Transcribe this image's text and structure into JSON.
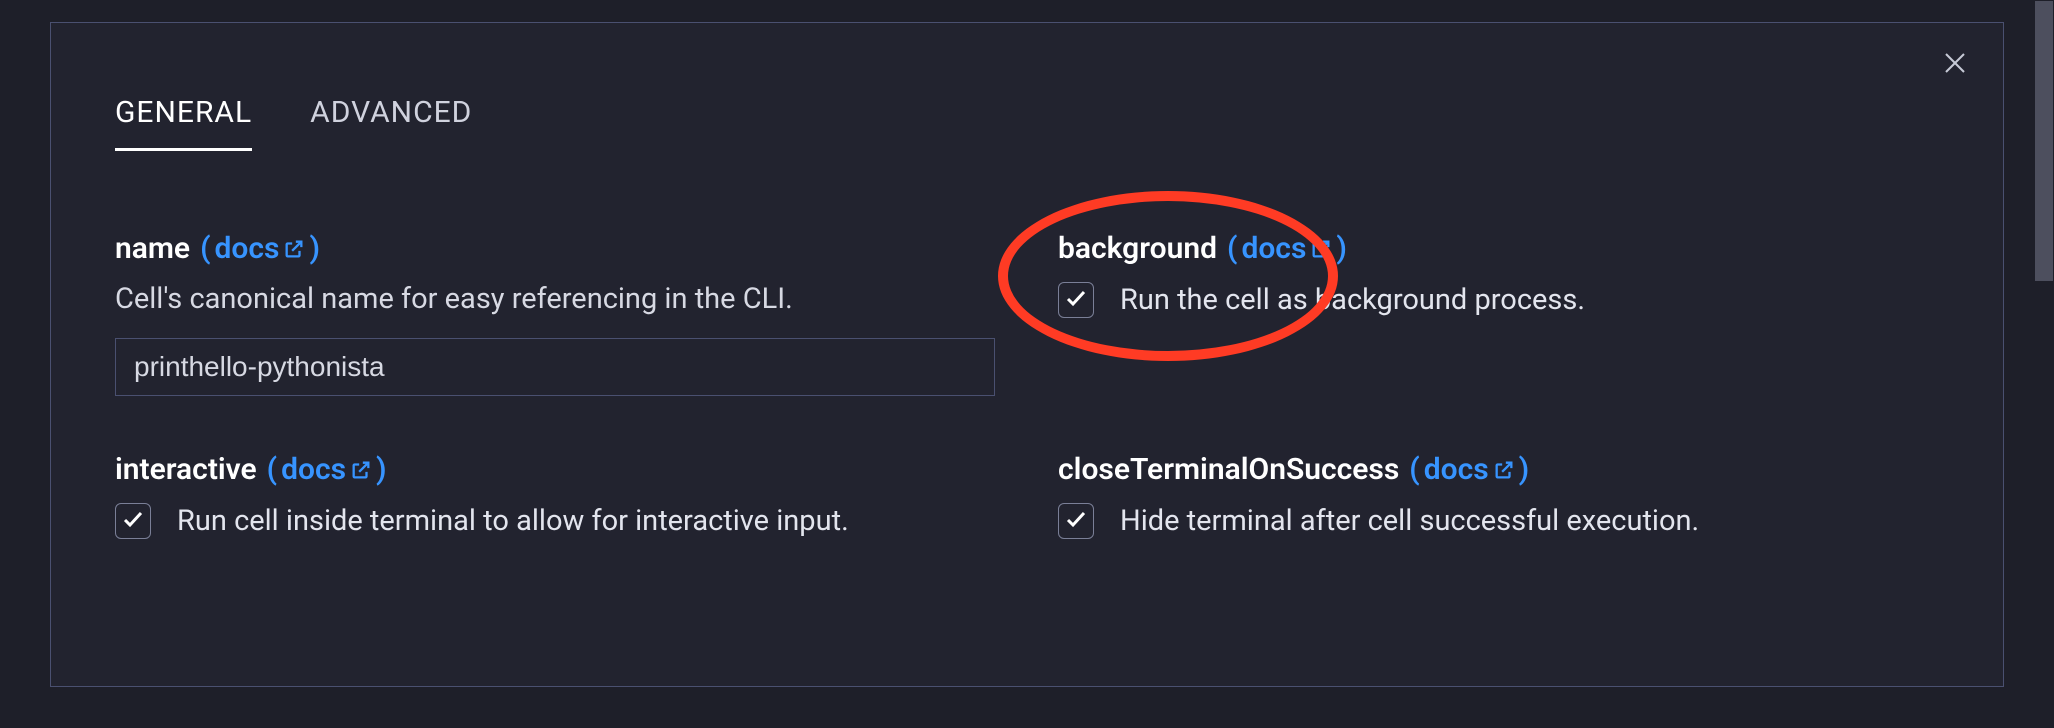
{
  "tabs": {
    "general": "GENERAL",
    "advanced": "ADVANCED"
  },
  "docs_label": "docs",
  "fields": {
    "name": {
      "label": "name",
      "description": "Cell's canonical name for easy referencing in the CLI.",
      "value": "printhello-pythonista"
    },
    "background": {
      "label": "background",
      "checkbox_label": "Run the cell as background process."
    },
    "interactive": {
      "label": "interactive",
      "checkbox_label": "Run cell inside terminal to allow for interactive input."
    },
    "closeTerminalOnSuccess": {
      "label": "closeTerminalOnSuccess",
      "checkbox_label": "Hide terminal after cell successful execution."
    }
  }
}
